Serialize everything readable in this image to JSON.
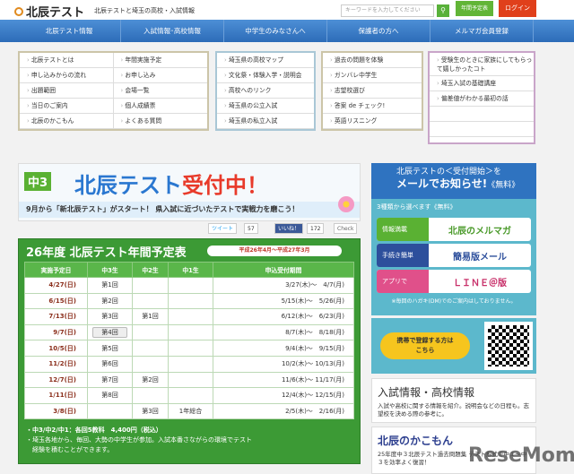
{
  "header": {
    "logo": "北辰テスト",
    "tagline": "北辰テストと埼玉の高校・入試情報",
    "search_placeholder": "キーワードを入力してください",
    "search_icon": "search-icon",
    "schedule_btn": "年間予定表",
    "login_btn": "ログイン"
  },
  "nav": [
    "北辰テスト情報",
    "入試情報･高校情報",
    "中学生のみなさんへ",
    "保護者の方へ",
    "メルマガ会員登録"
  ],
  "menu": {
    "col1a": [
      "北辰テストとは",
      "申し込みからの流れ",
      "出題範囲",
      "当日のご案内",
      "北辰のかこもん"
    ],
    "col1b": [
      "年間実施予定",
      "お申し込み",
      "会場一覧",
      "個人成績票",
      "よくある質問"
    ],
    "col2": [
      "埼玉県の高校マップ",
      "文化祭・体験入学・説明会",
      "高校へのリンク",
      "埼玉県の公立入試",
      "埼玉県の私立入試"
    ],
    "col3": [
      "過去の問題を体験",
      "ガンバレ中学生",
      "志望校選び",
      "答案 de チェック!",
      "英語リスニング"
    ],
    "col4": [
      "受験生のときに家族にしてもらって嬉しかったコト",
      "埼玉入試の基礎講座",
      "偏差値がわかる最初の話"
    ]
  },
  "banner": {
    "badge": "中3",
    "title": "北辰テスト",
    "title_red": "受付中！",
    "sub": "9月から「新北辰テスト」がスタート！ 県入試に近づいたテストで実戦力を磨こう！"
  },
  "social": {
    "tweet": "ツイート",
    "tweet_count": "57",
    "like": "いいね！",
    "like_count": "172",
    "check": "Check"
  },
  "schedule": {
    "title": "26年度 北辰テスト年間予定表",
    "period": "平成26年4月～平成27年3月",
    "headers": [
      "実施予定日",
      "中3生",
      "中2生",
      "中1生",
      "申込受付期間"
    ],
    "rows": [
      [
        "4/27(日)",
        "第1回",
        "",
        "",
        "3/27(木)～　4/7(月)"
      ],
      [
        "6/15(日)",
        "第2回",
        "",
        "",
        "5/15(木)～　5/26(月)"
      ],
      [
        "7/13(日)",
        "第3回",
        "第1回",
        "",
        "6/12(木)～　6/23(月)"
      ],
      [
        "9/7(日)",
        "第4回",
        "",
        "",
        "8/7(木)～　8/18(月)"
      ],
      [
        "10/5(日)",
        "第5回",
        "",
        "",
        "9/4(木)～　9/15(月)"
      ],
      [
        "11/2(日)",
        "第6回",
        "",
        "",
        "10/2(木)～ 10/13(月)"
      ],
      [
        "12/7(日)",
        "第7回",
        "第2回",
        "",
        "11/6(木)～ 11/17(月)"
      ],
      [
        "1/11(日)",
        "第8回",
        "",
        "",
        "12/4(木)～ 12/15(月)"
      ],
      [
        "3/8(日)",
        "",
        "第3回",
        "1年総合",
        "2/5(木)～　2/16(月)"
      ]
    ],
    "note1": "・中3/中2/中1：各回5教科　4,400円（税込）",
    "note2": "・埼玉各地から、毎回、大勢の中学生が参加。入試本番さながらの環境でテスト",
    "note3": "　経験を積むことができます。"
  },
  "mail": {
    "line1": "北辰テストの＜受付開始＞を",
    "line2": "メールでお知らせ!",
    "free": "《無料》",
    "choose": "3種類から選べます《無料》",
    "buttons": [
      {
        "tag": "情報満載",
        "label": "北辰のメルマガ",
        "color": "#5ab133",
        "text": "#4a9a2a"
      },
      {
        "tag": "手続き簡単",
        "label": "簡易版メール",
        "color": "#2d4f9c",
        "text": "#2d4f9c"
      },
      {
        "tag": "アプリで",
        "label": "ＬＩＮＥ＠版",
        "color": "#e0508a",
        "text": "#c8306a"
      }
    ],
    "note": "※毎回のハガキ(DM)でのご案内はしておりません。"
  },
  "mobile": {
    "text1": "携帯で登録する方は",
    "text2": "こちら"
  },
  "cards": [
    {
      "title": "入試情報・高校情報",
      "desc": "入試や高校に関する情報を紹介。説明会などの日程も。志望校を決める際の参考に。"
    },
    {
      "title": "北辰のかこもん",
      "desc": "25年度中３北辰テスト過去問題集 テスト形式で中１～中３を効率よく復習！"
    }
  ],
  "watermark": "ReseMom"
}
